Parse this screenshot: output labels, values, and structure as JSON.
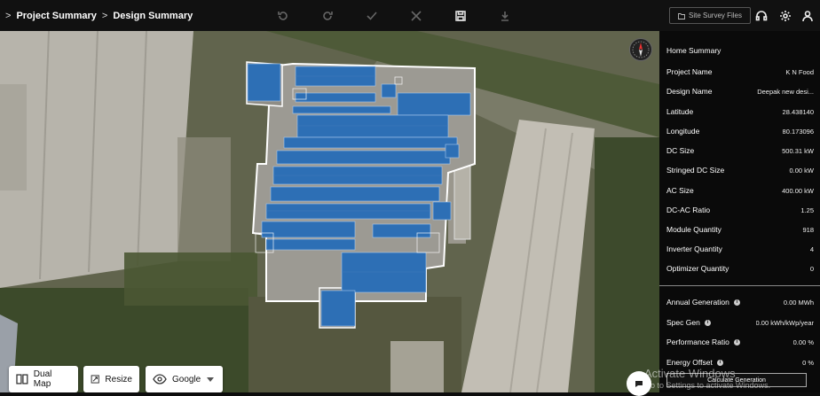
{
  "breadcrumb": {
    "sep1": ">",
    "item1": "Project Summary",
    "sep2": ">",
    "item2": "Design Summary"
  },
  "toolbar": {
    "icons": [
      "undo-icon",
      "redo-icon",
      "check-icon",
      "close-icon",
      "save-icon",
      "download-icon"
    ],
    "site_survey_label": "Site Survey Files"
  },
  "header_right_icons": [
    "headset-icon",
    "gear-icon",
    "user-icon"
  ],
  "summary": {
    "title": "Home Summary",
    "rows": [
      {
        "label": "Project Name",
        "value": "K N Food"
      },
      {
        "label": "Design Name",
        "value": "Deepak new desi..."
      },
      {
        "label": "Latitude",
        "value": "28.438140"
      },
      {
        "label": "Longitude",
        "value": "80.173096"
      },
      {
        "label": "DC Size",
        "value": "500.31 kW"
      },
      {
        "label": "Stringed DC Size",
        "value": "0.00 kW"
      },
      {
        "label": "AC Size",
        "value": "400.00 kW"
      },
      {
        "label": "DC-AC Ratio",
        "value": "1.25"
      },
      {
        "label": "Module Quantity",
        "value": "918"
      },
      {
        "label": "Inverter Quantity",
        "value": "4"
      },
      {
        "label": "Optimizer Quantity",
        "value": "0"
      }
    ],
    "generation": [
      {
        "label": "Annual Generation",
        "value": "0.00 MWh"
      },
      {
        "label": "Spec Gen",
        "value": "0.00 kWh/kWp/year"
      },
      {
        "label": "Performance Ratio",
        "value": "0.00 %"
      },
      {
        "label": "Energy Offset",
        "value": "0 %"
      }
    ],
    "calculate_label": "Calculate Generation"
  },
  "map_controls": {
    "dual_map": "Dual Map",
    "resize": "Resize",
    "provider": "Google"
  },
  "watermark": {
    "line1": "Activate Windows",
    "line2": "Go to Settings to activate Windows."
  },
  "colors": {
    "panel_bg": "#0a0a0a",
    "solar_panel": "#2d6fb5",
    "accent_divider": "#888888"
  }
}
